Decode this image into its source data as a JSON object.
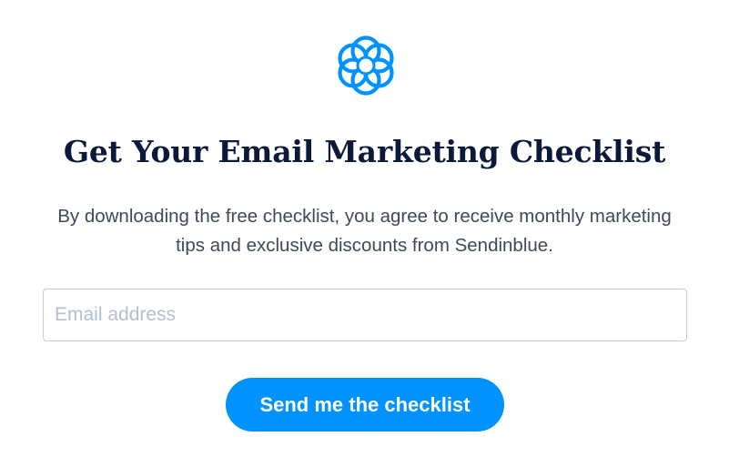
{
  "brand": {
    "logo_icon": "sendinblue-swirl-icon",
    "accent_color": "#0092ff"
  },
  "heading": {
    "title": "Get Your Email Marketing Checklist"
  },
  "description": {
    "text": "By downloading the free checklist, you agree to receive monthly marketing tips and exclusive discounts from Sendinblue."
  },
  "form": {
    "email_placeholder": "Email address",
    "email_value": "",
    "submit_label": "Send me the checklist"
  }
}
